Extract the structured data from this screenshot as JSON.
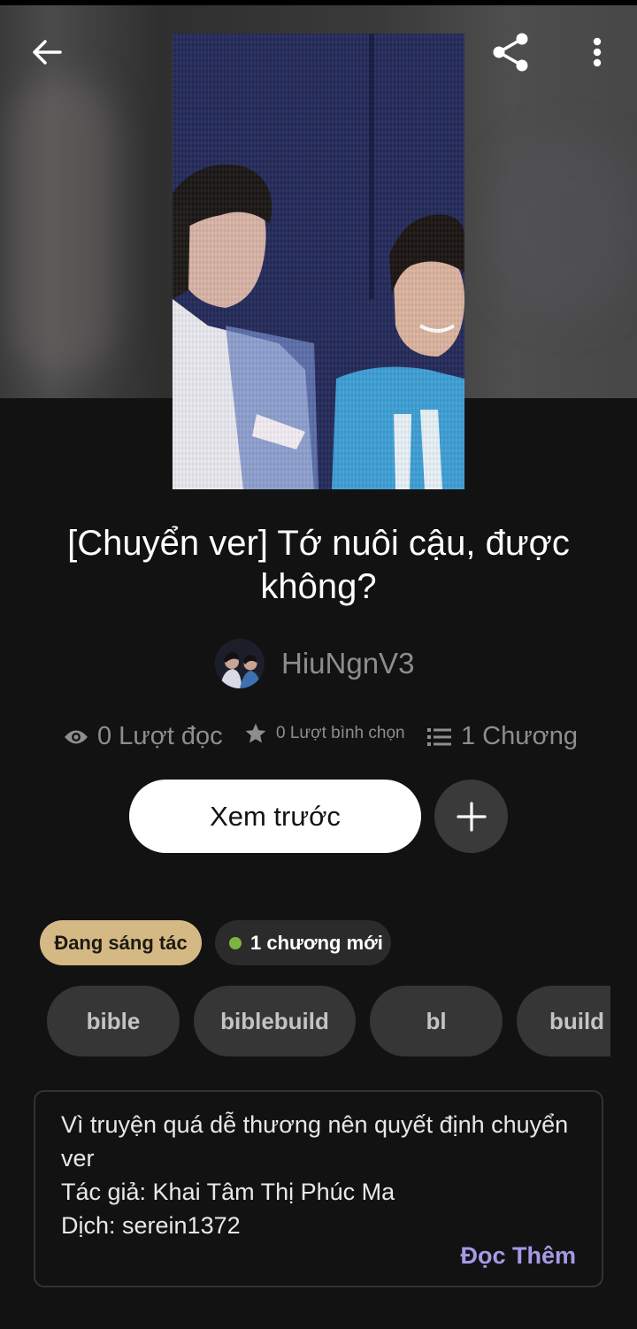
{
  "header": {
    "back_icon": "arrow-left-icon",
    "share_icon": "share-icon",
    "more_icon": "more-vertical-icon"
  },
  "story": {
    "title": "[Chuyển ver] Tớ nuôi cậu, được không?",
    "author": "HiuNgnV3"
  },
  "stats": {
    "reads": "0 Lượt đọc",
    "votes": "0 Lượt bình chọn",
    "parts": "1 Chương"
  },
  "actions": {
    "preview_label": "Xem trước",
    "add_icon": "plus-icon"
  },
  "badges": {
    "status": "Đang sáng tác",
    "new_chapters": "1 chương mới"
  },
  "tags": [
    "bible",
    "biblebuild",
    "bl",
    "build"
  ],
  "description": {
    "lines": [
      "Vì truyện quá dễ thương nên quyết định chuyển ver",
      "Tác giả: Khai Tâm Thị Phúc Ma",
      "Dịch: serein1372"
    ],
    "read_more": "Đọc Thêm"
  },
  "colors": {
    "background": "#121212",
    "status_badge": "#d5b985",
    "new_dot": "#7cb342",
    "read_more": "#a59ae8"
  }
}
